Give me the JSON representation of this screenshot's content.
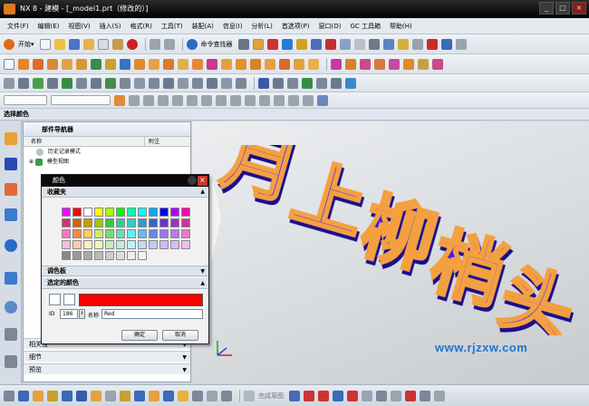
{
  "window": {
    "title": "NX 8 - 建模 - [_model1.prt（修改的）]",
    "minimize": "_",
    "maximize": "□",
    "close": "×"
  },
  "menu": [
    "文件(F)",
    "编辑(E)",
    "视图(V)",
    "插入(S)",
    "格式(R)",
    "工具(T)",
    "装配(A)",
    "信息(I)",
    "分析(L)",
    "首选项(P)",
    "窗口(O)",
    "GC 工具箱",
    "帮助(H)"
  ],
  "toolbar": {
    "start_label": "开始▾",
    "command_finder_label": "命令查找器"
  },
  "selection_bar": {
    "label": "选择颜色"
  },
  "part_navigator": {
    "title": "部件导航器",
    "col_name": "名称",
    "col_note": "附注",
    "rows": [
      "历史记录模式",
      "模型视图"
    ],
    "sections": [
      "相关性",
      "细节",
      "预览"
    ]
  },
  "color_dialog": {
    "title": "颜色",
    "favorites_label": "收藏夹",
    "palette_label": "调色板",
    "selected_color_label": "选定的颜色",
    "id_label": "ID",
    "id_value": "186",
    "name_label": "名称",
    "name_value": "Red",
    "ok_label": "确定",
    "cancel_label": "取消",
    "selected_color": "#ff0000",
    "swatches": [
      "#ff00ff",
      "#ff0000",
      "#ffffff",
      "#ffff00",
      "#aaff00",
      "#00ff00",
      "#00ffaa",
      "#00ffff",
      "#00aaff",
      "#0000ff",
      "#aa00ff",
      "#ff00aa",
      "#cc3377",
      "#cc6600",
      "#cc9900",
      "#99cc00",
      "#33cc33",
      "#33cc99",
      "#33cccc",
      "#3399cc",
      "#3366cc",
      "#6633cc",
      "#9933cc",
      "#cc3399",
      "#ff77bb",
      "#ff8844",
      "#ffcc66",
      "#ccee66",
      "#77dd77",
      "#66ddbb",
      "#66eeee",
      "#66bbee",
      "#6688ee",
      "#9977ee",
      "#bb77ee",
      "#ee77cc",
      "#ffbbdd",
      "#ffccaa",
      "#ffeebb",
      "#eef7bb",
      "#bbeebb",
      "#bbeedd",
      "#bbf5f5",
      "#bbddf5",
      "#bbccf5",
      "#ccbbf5",
      "#ddbbf5",
      "#f5bbe5",
      "#888888",
      "#999999",
      "#aaaaaa",
      "#bbbbbb",
      "#cccccc",
      "#dddddd",
      "#eeeeee",
      "#f5f5f5"
    ]
  },
  "scene": {
    "text_3d": "月上柳梢头",
    "text_color": "#3b1ee6",
    "outline_color": "#f4a040",
    "watermark": "www.rjzxw.com"
  },
  "status_bar": {
    "sketch_label": "完成草图"
  }
}
